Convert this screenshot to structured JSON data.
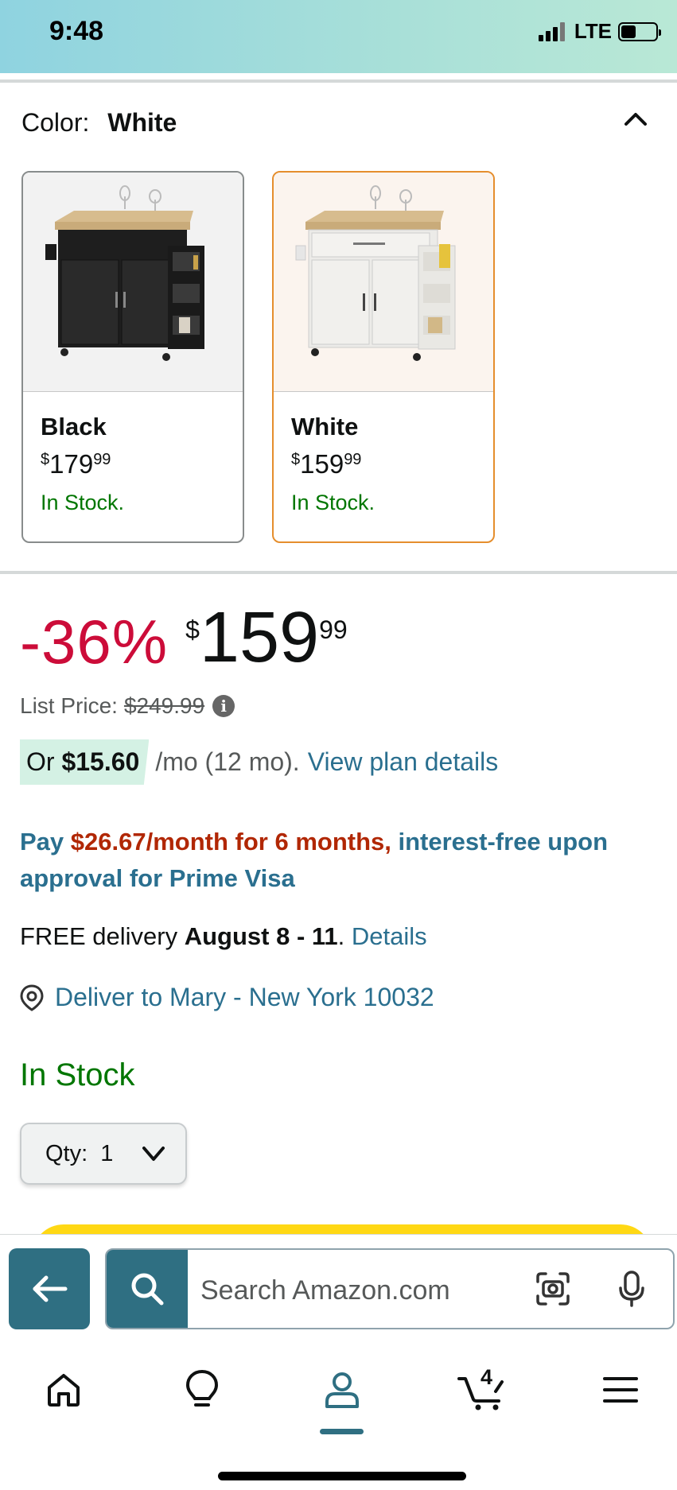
{
  "status_bar": {
    "time": "9:48",
    "network": "LTE"
  },
  "color_selector": {
    "label": "Color:",
    "selected": "White",
    "options": [
      {
        "name": "Black",
        "price_whole": "179",
        "price_fraction": "99",
        "currency": "$",
        "stock": "In Stock."
      },
      {
        "name": "White",
        "price_whole": "159",
        "price_fraction": "99",
        "currency": "$",
        "stock": "In Stock."
      }
    ]
  },
  "pricing": {
    "discount": "-36%",
    "currency": "$",
    "price_whole": "159",
    "price_fraction": "99",
    "list_price_label": "List Price:",
    "list_price": "$249.99",
    "monthly_prefix": "Or",
    "monthly_amount": "$15.60",
    "monthly_terms": "/mo (12 mo).",
    "monthly_link": "View plan details"
  },
  "visa_offer": {
    "prefix": "Pay",
    "amount": "$26.67/month for 6 months,",
    "suffix": "interest-free upon approval for Prime Visa"
  },
  "delivery": {
    "prefix": "FREE delivery",
    "dates": "August 8 - 11",
    "period": ".",
    "link": "Details",
    "deliver_to": "Deliver to Mary - New York 10032"
  },
  "availability": "In Stock",
  "quantity": {
    "label": "Qty:",
    "value": "1"
  },
  "search": {
    "placeholder": "Search Amazon.com"
  },
  "nav": {
    "items": [
      "home-icon",
      "lightbulb-icon",
      "account-icon",
      "cart-icon",
      "menu-icon"
    ],
    "cart_count": "4"
  },
  "colors": {
    "accent_teal": "#2f6f82",
    "link_blue": "#2a6f8f",
    "deal_red": "#cc0c39",
    "stock_green": "#007600",
    "selected_border": "#e58e2d"
  }
}
